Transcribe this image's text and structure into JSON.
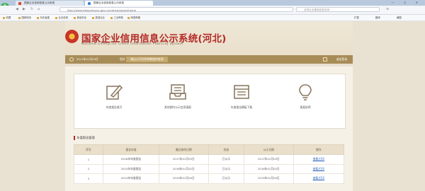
{
  "browser": {
    "tabs": [
      {
        "label": "国家企业信用信息公示系统"
      },
      {
        "label": "国家企业信用信息公示系统"
      }
    ],
    "window_controls": "— ☐ ✕",
    "url": "http://www.hebscztxyxx.gov.cn/notice/report/home",
    "search_placeholder": "全球企业基础信息查询",
    "bookmarks": [
      "收藏",
      "国家网页",
      "河北省直",
      "企业信用",
      "食品安全",
      "旅游企业",
      "工业邮政",
      "网易邮箱"
    ],
    "right_bookmarks": [
      "扩展",
      "翻译",
      "截图"
    ]
  },
  "site": {
    "title": "国家企业信用信息公示系统(河北)",
    "subtitle": "National Enterprise Credit Information Publicity System",
    "date": "2017年01月03日",
    "location_label": "您好",
    "location_value": "（确认公司名称的数据库查找）",
    "logout": "退出登录"
  },
  "actions": [
    {
      "label": "年度报告填写",
      "icon": "pen-icon"
    },
    {
      "label": "其他即时公示信息填报",
      "icon": "inbox-tray-icon"
    },
    {
      "label": "年度报告模板下载",
      "icon": "document-list-icon"
    },
    {
      "label": "填报说明",
      "icon": "lightbulb-icon"
    }
  ],
  "section_title": "年度报告管理",
  "table": {
    "headers": [
      "序号",
      "报告年度",
      "最后修改日期",
      "状态",
      "公示日期",
      "操作"
    ],
    "rows": [
      [
        "1",
        "2016年年度报告",
        "2017年01月03日",
        "已公示",
        "2017年01月03日",
        "查看/打印"
      ],
      [
        "2",
        "2015年年度报告",
        "2016年01月02日",
        "已公示",
        "2016年01月02日",
        "查看/打印"
      ],
      [
        "3",
        "2014年年度报告",
        "2015年01月04日",
        "已公示",
        "2015年01月04日",
        "查看/打印"
      ]
    ]
  },
  "colors": {
    "brand_red": "#b42a27",
    "bar_brown": "#a88c57",
    "page_bg": "#e9e2d2"
  }
}
